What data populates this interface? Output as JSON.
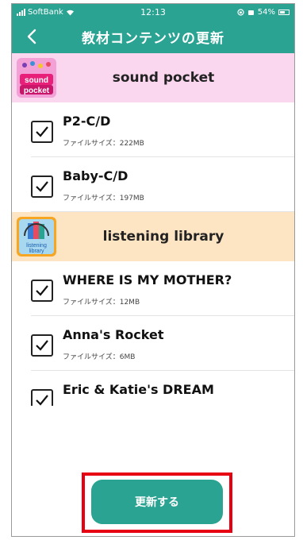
{
  "status_bar": {
    "carrier": "SoftBank",
    "time": "12:13",
    "battery": "54%"
  },
  "nav": {
    "title": "教材コンテンツの更新",
    "back_icon": "chevron-left-icon"
  },
  "sections": [
    {
      "title": "sound pocket",
      "logo_text_1": "sound",
      "logo_text_2": "pocket",
      "items": [
        {
          "title": "P2-C/D",
          "size": "ファイルサイズ：222MB",
          "checked": true
        },
        {
          "title": "Baby-C/D",
          "size": "ファイルサイズ：197MB",
          "checked": true
        }
      ]
    },
    {
      "title": "listening library",
      "logo_text_1": "listening",
      "logo_text_2": "library",
      "items": [
        {
          "title": "WHERE IS MY MOTHER?",
          "size": "ファイルサイズ：12MB",
          "checked": true
        },
        {
          "title": "Anna's Rocket",
          "size": "ファイルサイズ：6MB",
          "checked": true
        },
        {
          "title": "Eric & Katie's DREAM",
          "size": "",
          "checked": true
        }
      ]
    }
  ],
  "update_button": {
    "label": "更新する"
  },
  "colors": {
    "primary": "#2aa393",
    "section_pink": "#fbd6ef",
    "section_peach": "#fde4c3",
    "highlight": "#e60012"
  }
}
